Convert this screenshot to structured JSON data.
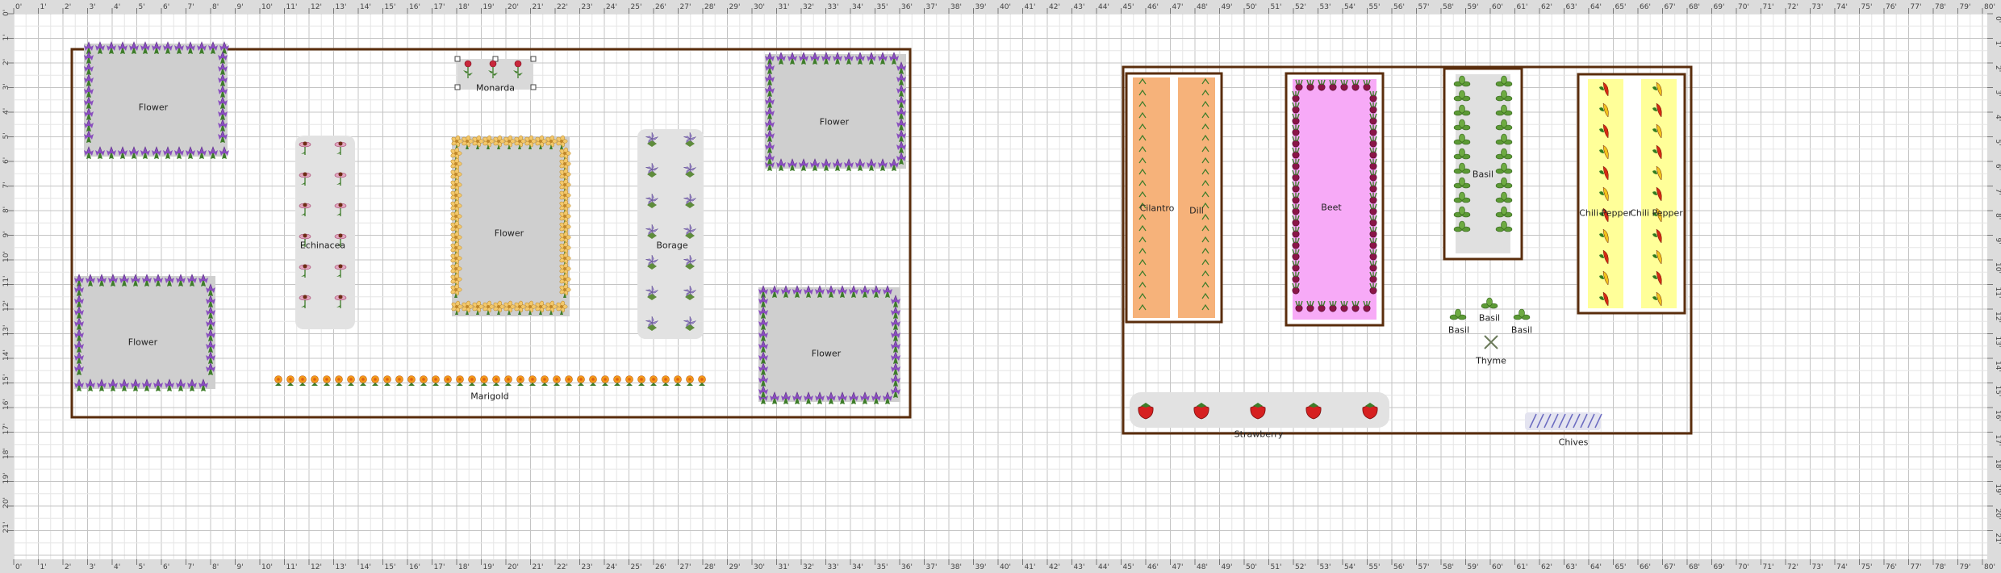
{
  "rulers": {
    "top": [
      "0'",
      "1'",
      "2'",
      "3'",
      "4'",
      "5'",
      "6'",
      "7'",
      "8'",
      "9'",
      "10'",
      "11'",
      "12'",
      "13'",
      "14'",
      "15'",
      "16'",
      "17'",
      "18'",
      "19'",
      "20'",
      "21'",
      "22'",
      "23'",
      "24'",
      "25'",
      "26'",
      "27'",
      "28'",
      "29'",
      "30'",
      "31'",
      "32'",
      "33'",
      "34'",
      "35'",
      "36'",
      "37'",
      "38'",
      "39'",
      "40'",
      "41'",
      "42'",
      "43'",
      "44'",
      "45'",
      "46'",
      "47'",
      "48'",
      "49'",
      "50'",
      "51'",
      "52'",
      "53'",
      "54'",
      "55'",
      "56'",
      "57'",
      "58'",
      "59'",
      "60'",
      "61'",
      "62'",
      "63'",
      "64'",
      "65'",
      "66'",
      "67'",
      "68'",
      "69'",
      "70'",
      "71'",
      "72'",
      "73'",
      "74'",
      "75'",
      "76'",
      "77'",
      "78'",
      "79'",
      "80'"
    ],
    "side": [
      "0'",
      "1'",
      "2'",
      "3'",
      "4'",
      "5'",
      "6'",
      "7'",
      "8'",
      "9'",
      "10'",
      "11'",
      "12'",
      "13'",
      "14'",
      "15'",
      "16'",
      "17'",
      "18'",
      "19'",
      "20'",
      "21'"
    ]
  },
  "colors": {
    "bed_border": "#5a2d0c",
    "grid_minor": "#e6e6e6",
    "grid_major": "#c4c4c4",
    "ruler_bg": "#dcdcdc",
    "flower_fill": "#cfcfcf",
    "iris_purple": "#8a4fbf",
    "iris_green": "#3e7d2a",
    "cilantro_fill": "#f6b27a",
    "beet_fill": "#f7aaf7",
    "pepper_fill": "#ffff99",
    "strawberry_red": "#d62020"
  },
  "plants": {
    "flower_1": "Flower",
    "flower_2": "Flower",
    "flower_3": "Flower",
    "flower_4": "Flower",
    "flower_5": "Flower",
    "monarda": "Monarda",
    "echinacea": "Echinacea",
    "borage": "Borage",
    "marigold": "Marigold",
    "cilantro": "Cilantro",
    "dill": "Dill",
    "beet": "Beet",
    "basil_bed": "Basil",
    "chili_1": "Chili Pepper",
    "chili_2": "Chili Pepper",
    "basil_1": "Basil",
    "basil_2": "Basil",
    "basil_3": "Basil",
    "thyme": "Thyme",
    "strawberry": "Strawberry",
    "chives": "Chives"
  }
}
